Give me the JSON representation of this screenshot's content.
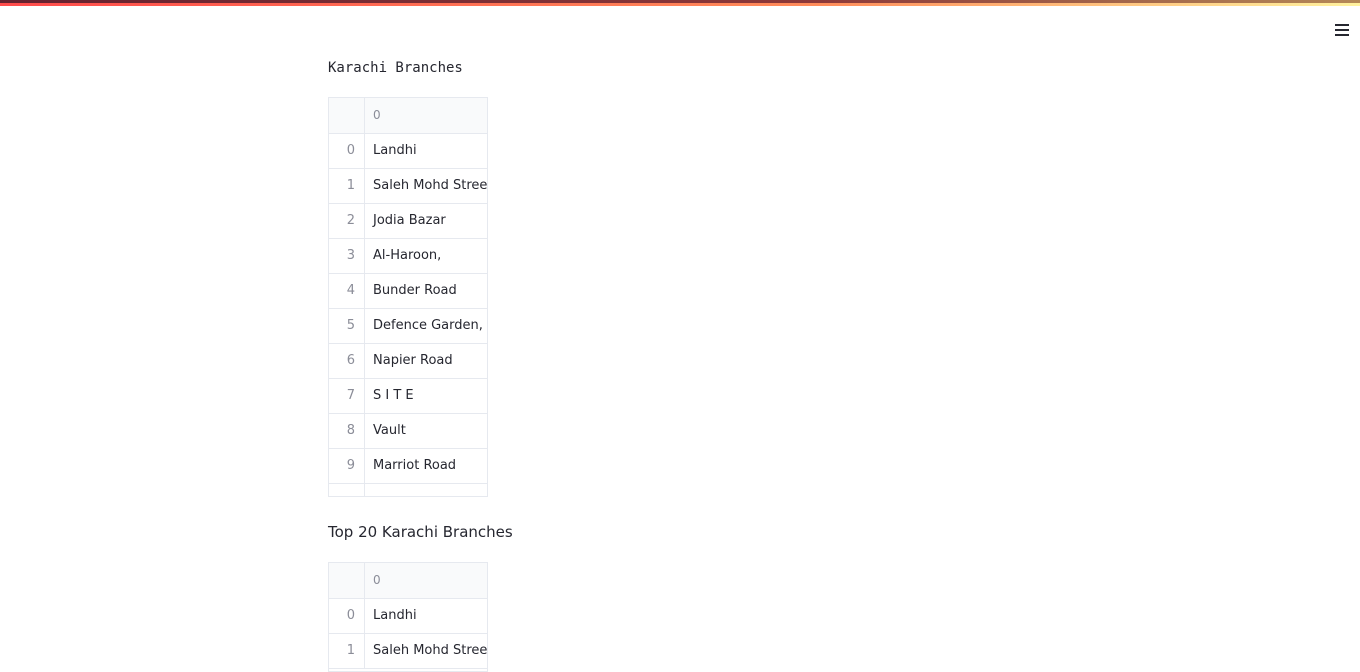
{
  "theme": {
    "accent": "#ff4b4b",
    "border": "#e6e9ef",
    "muted": "#8b8d98",
    "text": "#262730"
  },
  "header": {
    "menu_icon": "hamburger-menu-icon"
  },
  "section1": {
    "title": "Karachi Branches",
    "table": {
      "column_header": "0",
      "rows": [
        {
          "index": "0",
          "value": "Landhi"
        },
        {
          "index": "1",
          "value": "Saleh Mohd Street"
        },
        {
          "index": "2",
          "value": "Jodia Bazar"
        },
        {
          "index": "3",
          "value": "Al-Haroon,"
        },
        {
          "index": "4",
          "value": "Bunder Road"
        },
        {
          "index": "5",
          "value": "Defence Garden,"
        },
        {
          "index": "6",
          "value": "Napier Road"
        },
        {
          "index": "7",
          "value": "S I T E"
        },
        {
          "index": "8",
          "value": "Vault"
        },
        {
          "index": "9",
          "value": "Marriot Road"
        }
      ]
    }
  },
  "section2": {
    "title": "Top 20 Karachi Branches",
    "table": {
      "column_header": "0",
      "rows": [
        {
          "index": "0",
          "value": "Landhi"
        },
        {
          "index": "1",
          "value": "Saleh Mohd Street"
        }
      ]
    }
  }
}
